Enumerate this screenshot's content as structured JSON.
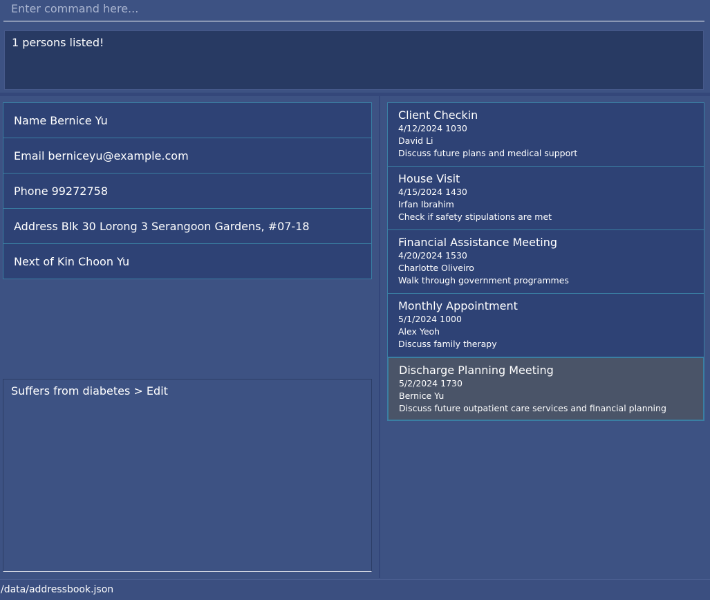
{
  "command": {
    "placeholder": "Enter command here...",
    "value": ""
  },
  "result": {
    "text": "1 persons listed!"
  },
  "person": {
    "name": {
      "label": "Name",
      "value": "Bernice Yu"
    },
    "email": {
      "label": "Email",
      "value": "berniceyu@example.com"
    },
    "phone": {
      "label": "Phone",
      "value": "99272758"
    },
    "address": {
      "label": "Address",
      "value": "Blk 30 Lorong 3 Serangoon Gardens, #07-18"
    },
    "next_of_kin": {
      "label": "Next of Kin",
      "value": "Choon Yu"
    }
  },
  "remarks": {
    "text": "Suffers from diabetes > Edit"
  },
  "appointments": [
    {
      "title": "Client Checkin",
      "datetime": "4/12/2024 1030",
      "person": "David Li",
      "description": "Discuss future plans and medical support"
    },
    {
      "title": "House Visit",
      "datetime": "4/15/2024 1430",
      "person": "Irfan Ibrahim",
      "description": "Check if safety stipulations are met"
    },
    {
      "title": "Financial Assistance Meeting",
      "datetime": "4/20/2024 1530",
      "person": "Charlotte Oliveiro",
      "description": "Walk through government programmes"
    },
    {
      "title": "Monthly Appointment",
      "datetime": "5/1/2024 1000",
      "person": "Alex Yeoh",
      "description": "Discuss family therapy"
    },
    {
      "title": "Discharge Planning Meeting",
      "datetime": "5/2/2024 1730",
      "person": "Bernice Yu",
      "description": "Discuss future outpatient care services and financial planning",
      "selected": true
    }
  ],
  "status": {
    "path": "/data/addressbook.json"
  },
  "colors": {
    "background": "#3d5283",
    "card": "#2e4275",
    "card_border": "#3a7fa3",
    "result_bg": "#283a63",
    "selected_card": "#4a5468"
  }
}
